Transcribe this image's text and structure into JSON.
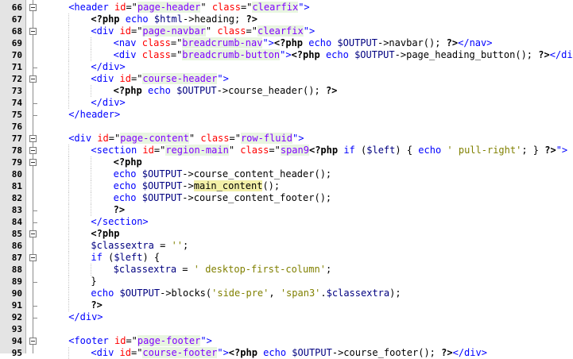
{
  "editor": {
    "lines": [
      {
        "n": "66",
        "indent": 1,
        "fold": "open",
        "tokens": [
          {
            "t": "<header ",
            "c": "tag"
          },
          {
            "t": "id",
            "c": "attr"
          },
          {
            "t": "=\"",
            "c": "sym"
          },
          {
            "t": "page-header",
            "c": "val"
          },
          {
            "t": "\" ",
            "c": "sym"
          },
          {
            "t": "class",
            "c": "attr"
          },
          {
            "t": "=\"",
            "c": "sym"
          },
          {
            "t": "clearfix",
            "c": "val"
          },
          {
            "t": "\">",
            "c": "tag"
          }
        ]
      },
      {
        "n": "67",
        "indent": 2,
        "fold": "line",
        "tokens": [
          {
            "t": "<?php ",
            "c": "php"
          },
          {
            "t": "echo ",
            "c": "kw"
          },
          {
            "t": "$html",
            "c": "var"
          },
          {
            "t": "->heading; ",
            "c": "sym"
          },
          {
            "t": "?>",
            "c": "php"
          }
        ]
      },
      {
        "n": "68",
        "indent": 2,
        "fold": "open",
        "tokens": [
          {
            "t": "<div ",
            "c": "tag"
          },
          {
            "t": "id",
            "c": "attr"
          },
          {
            "t": "=\"",
            "c": "sym"
          },
          {
            "t": "page-navbar",
            "c": "val"
          },
          {
            "t": "\" ",
            "c": "sym"
          },
          {
            "t": "class",
            "c": "attr"
          },
          {
            "t": "=\"",
            "c": "sym"
          },
          {
            "t": "clearfix",
            "c": "val"
          },
          {
            "t": "\">",
            "c": "tag"
          }
        ]
      },
      {
        "n": "69",
        "indent": 3,
        "fold": "line",
        "tokens": [
          {
            "t": "<nav ",
            "c": "tag"
          },
          {
            "t": "class",
            "c": "attr"
          },
          {
            "t": "=\"",
            "c": "sym"
          },
          {
            "t": "breadcrumb-nav",
            "c": "val"
          },
          {
            "t": "\">",
            "c": "tag"
          },
          {
            "t": "<?php ",
            "c": "php"
          },
          {
            "t": "echo ",
            "c": "kw"
          },
          {
            "t": "$OUTPUT",
            "c": "var"
          },
          {
            "t": "->navbar(); ",
            "c": "sym"
          },
          {
            "t": "?>",
            "c": "php"
          },
          {
            "t": "</nav>",
            "c": "tag"
          }
        ]
      },
      {
        "n": "70",
        "indent": 3,
        "fold": "line",
        "tokens": [
          {
            "t": "<div ",
            "c": "tag"
          },
          {
            "t": "class",
            "c": "attr"
          },
          {
            "t": "=\"",
            "c": "sym"
          },
          {
            "t": "breadcrumb-button",
            "c": "val"
          },
          {
            "t": "\">",
            "c": "tag"
          },
          {
            "t": "<?php ",
            "c": "php"
          },
          {
            "t": "echo ",
            "c": "kw"
          },
          {
            "t": "$OUTPUT",
            "c": "var"
          },
          {
            "t": "->page_heading_button(); ",
            "c": "sym"
          },
          {
            "t": "?>",
            "c": "php"
          },
          {
            "t": "</div>",
            "c": "tag"
          }
        ]
      },
      {
        "n": "71",
        "indent": 2,
        "fold": "end",
        "tokens": [
          {
            "t": "</div>",
            "c": "tag"
          }
        ]
      },
      {
        "n": "72",
        "indent": 2,
        "fold": "open",
        "tokens": [
          {
            "t": "<div ",
            "c": "tag"
          },
          {
            "t": "id",
            "c": "attr"
          },
          {
            "t": "=\"",
            "c": "sym"
          },
          {
            "t": "course-header",
            "c": "val"
          },
          {
            "t": "\">",
            "c": "tag"
          }
        ]
      },
      {
        "n": "73",
        "indent": 3,
        "fold": "line",
        "tokens": [
          {
            "t": "<?php ",
            "c": "php"
          },
          {
            "t": "echo ",
            "c": "kw"
          },
          {
            "t": "$OUTPUT",
            "c": "var"
          },
          {
            "t": "->course_header(); ",
            "c": "sym"
          },
          {
            "t": "?>",
            "c": "php"
          }
        ]
      },
      {
        "n": "74",
        "indent": 2,
        "fold": "end",
        "tokens": [
          {
            "t": "</div>",
            "c": "tag"
          }
        ]
      },
      {
        "n": "75",
        "indent": 1,
        "fold": "end",
        "tokens": [
          {
            "t": "</header>",
            "c": "tag"
          }
        ]
      },
      {
        "n": "76",
        "indent": 0,
        "fold": "none",
        "tokens": []
      },
      {
        "n": "77",
        "indent": 1,
        "fold": "open",
        "tokens": [
          {
            "t": "<div ",
            "c": "tag"
          },
          {
            "t": "id",
            "c": "attr"
          },
          {
            "t": "=\"",
            "c": "sym"
          },
          {
            "t": "page-content",
            "c": "val"
          },
          {
            "t": "\" ",
            "c": "sym"
          },
          {
            "t": "class",
            "c": "attr"
          },
          {
            "t": "=\"",
            "c": "sym"
          },
          {
            "t": "row-fluid",
            "c": "val"
          },
          {
            "t": "\">",
            "c": "tag"
          }
        ]
      },
      {
        "n": "78",
        "indent": 2,
        "fold": "open",
        "tokens": [
          {
            "t": "<section ",
            "c": "tag"
          },
          {
            "t": "id",
            "c": "attr"
          },
          {
            "t": "=\"",
            "c": "sym"
          },
          {
            "t": "region-main",
            "c": "val"
          },
          {
            "t": "\" ",
            "c": "sym"
          },
          {
            "t": "class",
            "c": "attr"
          },
          {
            "t": "=\"",
            "c": "sym"
          },
          {
            "t": "span9",
            "c": "val"
          },
          {
            "t": "<?php ",
            "c": "php"
          },
          {
            "t": "if ",
            "c": "kw"
          },
          {
            "t": "(",
            "c": "sym"
          },
          {
            "t": "$left",
            "c": "var"
          },
          {
            "t": ") { ",
            "c": "sym"
          },
          {
            "t": "echo ",
            "c": "kw"
          },
          {
            "t": "' pull-right'",
            "c": "str"
          },
          {
            "t": "; } ",
            "c": "sym"
          },
          {
            "t": "?>",
            "c": "php"
          },
          {
            "t": "\">",
            "c": "tag"
          }
        ]
      },
      {
        "n": "79",
        "indent": 3,
        "fold": "open",
        "tokens": [
          {
            "t": "<?php",
            "c": "php"
          }
        ]
      },
      {
        "n": "80",
        "indent": 3,
        "fold": "line",
        "tokens": [
          {
            "t": "echo ",
            "c": "kw"
          },
          {
            "t": "$OUTPUT",
            "c": "var"
          },
          {
            "t": "->course_content_header();",
            "c": "sym"
          }
        ]
      },
      {
        "n": "81",
        "indent": 3,
        "fold": "line",
        "tokens": [
          {
            "t": "echo ",
            "c": "kw"
          },
          {
            "t": "$OUTPUT",
            "c": "var"
          },
          {
            "t": "->",
            "c": "sym"
          },
          {
            "t": "main_content",
            "c": "hl"
          },
          {
            "t": "();",
            "c": "sym"
          }
        ]
      },
      {
        "n": "82",
        "indent": 3,
        "fold": "line",
        "tokens": [
          {
            "t": "echo ",
            "c": "kw"
          },
          {
            "t": "$OUTPUT",
            "c": "var"
          },
          {
            "t": "->course_content_footer();",
            "c": "sym"
          }
        ]
      },
      {
        "n": "83",
        "indent": 3,
        "fold": "end",
        "tokens": [
          {
            "t": "?>",
            "c": "php"
          }
        ]
      },
      {
        "n": "84",
        "indent": 2,
        "fold": "end",
        "tokens": [
          {
            "t": "</section>",
            "c": "tag"
          }
        ]
      },
      {
        "n": "85",
        "indent": 2,
        "fold": "open",
        "tokens": [
          {
            "t": "<?php",
            "c": "php"
          }
        ]
      },
      {
        "n": "86",
        "indent": 2,
        "fold": "line",
        "tokens": [
          {
            "t": "$classextra",
            "c": "var"
          },
          {
            "t": " = ",
            "c": "sym"
          },
          {
            "t": "''",
            "c": "str"
          },
          {
            "t": ";",
            "c": "sym"
          }
        ]
      },
      {
        "n": "87",
        "indent": 2,
        "fold": "open",
        "tokens": [
          {
            "t": "if ",
            "c": "kw"
          },
          {
            "t": "(",
            "c": "sym"
          },
          {
            "t": "$left",
            "c": "var"
          },
          {
            "t": ") {",
            "c": "sym"
          }
        ]
      },
      {
        "n": "88",
        "indent": 3,
        "fold": "line",
        "tokens": [
          {
            "t": "$classextra",
            "c": "var"
          },
          {
            "t": " = ",
            "c": "sym"
          },
          {
            "t": "' desktop-first-column'",
            "c": "str"
          },
          {
            "t": ";",
            "c": "sym"
          }
        ]
      },
      {
        "n": "89",
        "indent": 2,
        "fold": "end",
        "tokens": [
          {
            "t": "}",
            "c": "sym"
          }
        ]
      },
      {
        "n": "90",
        "indent": 2,
        "fold": "line",
        "tokens": [
          {
            "t": "echo ",
            "c": "kw"
          },
          {
            "t": "$OUTPUT",
            "c": "var"
          },
          {
            "t": "->blocks(",
            "c": "sym"
          },
          {
            "t": "'side-pre'",
            "c": "str"
          },
          {
            "t": ", ",
            "c": "sym"
          },
          {
            "t": "'span3'",
            "c": "str"
          },
          {
            "t": ".",
            "c": "sym"
          },
          {
            "t": "$classextra",
            "c": "var"
          },
          {
            "t": ");",
            "c": "sym"
          }
        ]
      },
      {
        "n": "91",
        "indent": 2,
        "fold": "end",
        "tokens": [
          {
            "t": "?>",
            "c": "php"
          }
        ]
      },
      {
        "n": "92",
        "indent": 1,
        "fold": "end",
        "tokens": [
          {
            "t": "</div>",
            "c": "tag"
          }
        ]
      },
      {
        "n": "93",
        "indent": 0,
        "fold": "none",
        "tokens": []
      },
      {
        "n": "94",
        "indent": 1,
        "fold": "open",
        "tokens": [
          {
            "t": "<footer ",
            "c": "tag"
          },
          {
            "t": "id",
            "c": "attr"
          },
          {
            "t": "=\"",
            "c": "sym"
          },
          {
            "t": "page-footer",
            "c": "val"
          },
          {
            "t": "\">",
            "c": "tag"
          }
        ]
      },
      {
        "n": "95",
        "indent": 2,
        "fold": "line",
        "tokens": [
          {
            "t": "<div ",
            "c": "tag"
          },
          {
            "t": "id",
            "c": "attr"
          },
          {
            "t": "=\"",
            "c": "sym"
          },
          {
            "t": "course-footer",
            "c": "val"
          },
          {
            "t": "\">",
            "c": "tag"
          },
          {
            "t": "<?php ",
            "c": "php"
          },
          {
            "t": "echo ",
            "c": "kw"
          },
          {
            "t": "$OUTPUT",
            "c": "var"
          },
          {
            "t": "->course_footer(); ",
            "c": "sym"
          },
          {
            "t": "?>",
            "c": "php"
          },
          {
            "t": "</div>",
            "c": "tag"
          }
        ]
      }
    ]
  },
  "colors": {
    "tag": "#0000ff",
    "attribute": "#ff0000",
    "value": "#8000ff",
    "value_bg": "#e8f5e0",
    "string": "#808000",
    "variable": "#000080",
    "highlight_bg": "#f3f0a8",
    "gutter_bg": "#e4e4e4"
  }
}
